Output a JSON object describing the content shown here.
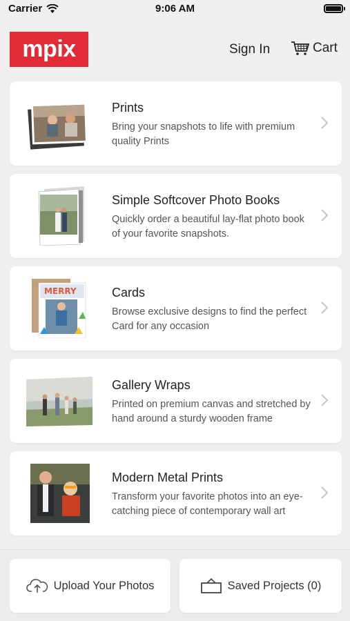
{
  "status_bar": {
    "carrier": "Carrier",
    "time": "9:06 AM"
  },
  "header": {
    "logo": "mpix",
    "sign_in": "Sign In",
    "cart": "Cart"
  },
  "products": [
    {
      "title": "Prints",
      "description": "Bring your snapshots to life with premium quality Prints",
      "icon": "prints-thumbnail"
    },
    {
      "title": "Simple Softcover Photo Books",
      "description": "Quickly order a beautiful lay-flat photo book of your favorite snapshots.",
      "icon": "photobook-thumbnail"
    },
    {
      "title": "Cards",
      "description": "Browse exclusive designs to find the perfect Card for any occasion",
      "icon": "cards-thumbnail"
    },
    {
      "title": "Gallery Wraps",
      "description": "Printed on premium canvas and stretched by hand around a sturdy wooden frame",
      "icon": "gallery-wrap-thumbnail"
    },
    {
      "title": "Modern Metal Prints",
      "description": "Transform your favorite photos into an eye-catching piece of contemporary wall art",
      "icon": "metal-print-thumbnail"
    }
  ],
  "bottom_bar": {
    "upload": "Upload Your Photos",
    "saved": "Saved Projects (0)"
  },
  "colors": {
    "brand": "#e22b36",
    "background": "#efeff0",
    "card": "#ffffff"
  }
}
